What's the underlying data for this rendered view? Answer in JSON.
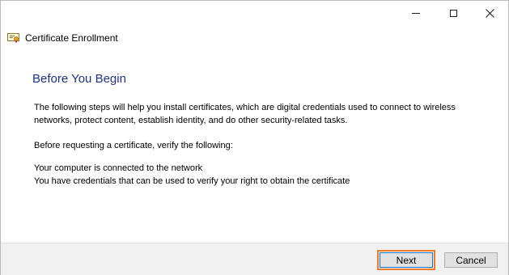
{
  "window": {
    "caption_buttons": {
      "minimize_icon": "minimize-icon",
      "maximize_icon": "maximize-icon",
      "close_icon": "close-icon"
    }
  },
  "wizard": {
    "title": "Certificate Enrollment",
    "icon": "certificate-icon"
  },
  "page": {
    "heading": "Before You Begin",
    "intro": "The following steps will help you install certificates, which are digital credentials used to connect to wireless networks, protect content, establish identity, and do other security-related tasks.",
    "verify_prompt": "Before requesting a certificate, verify the following:",
    "requirements": [
      "Your computer is connected to the network",
      "You have credentials that can be used to verify your right to obtain the certificate"
    ]
  },
  "footer": {
    "next_label": "Next",
    "cancel_label": "Cancel"
  },
  "colors": {
    "heading": "#1e3287",
    "highlight": "#f07a2a",
    "footer_bg": "#f0f0f0"
  }
}
